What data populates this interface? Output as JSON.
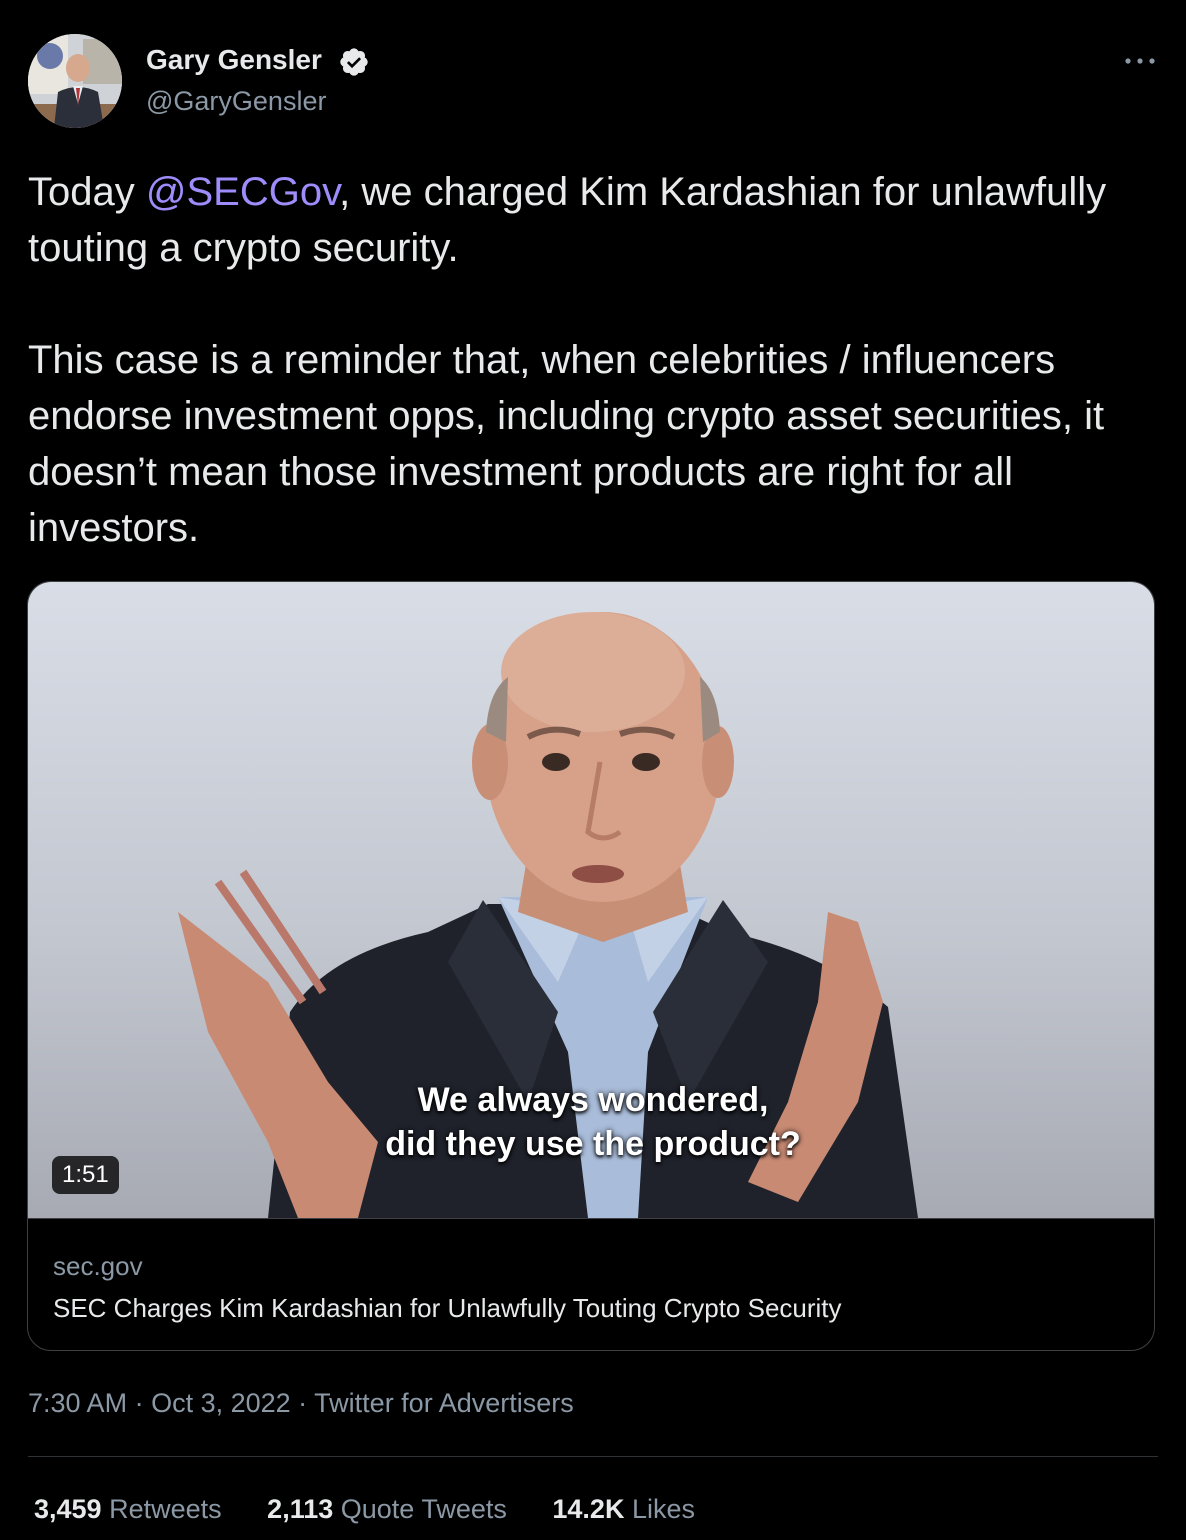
{
  "user": {
    "name": "Gary Gensler",
    "handle": "@GaryGensler",
    "verified": true
  },
  "tweet": {
    "text_prefix": "Today ",
    "mention": "@SECGov",
    "text_suffix": ", we charged Kim Kardashian for unlawfully touting a crypto security.",
    "paragraph2": "This case is a reminder that, when celebrities / influencers endorse investment opps, including crypto asset securities, it doesn’t mean those investment products are right for all investors."
  },
  "card": {
    "caption_line1": "We always wondered,",
    "caption_line2": "did they use the product?",
    "duration": "1:51",
    "domain": "sec.gov",
    "title": "SEC Charges Kim Kardashian for Unlawfully Touting Crypto Security"
  },
  "meta": {
    "time": "7:30 AM",
    "sep1": " · ",
    "date": "Oct 3, 2022",
    "sep2": " · ",
    "source": "Twitter for Advertisers"
  },
  "stats": {
    "retweets_count": "3,459",
    "retweets_label": "Retweets",
    "quotes_count": "2,113",
    "quotes_label": "Quote Tweets",
    "likes_count": "14.2K",
    "likes_label": "Likes"
  },
  "colors": {
    "background": "#000000",
    "text": "#e7e9ea",
    "secondary": "#8b98a5",
    "mention": "#9d8cf9",
    "border": "#3e4144"
  },
  "icons": [
    "verified-badge-icon",
    "more-options-icon"
  ]
}
